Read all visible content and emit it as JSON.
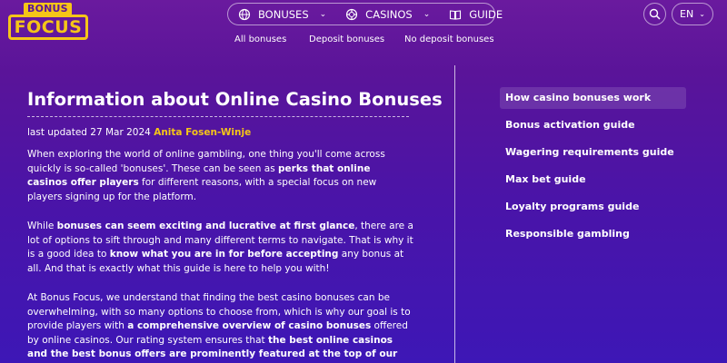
{
  "header": {
    "logo_top": "BONUS",
    "logo_bottom": "FOCUS",
    "nav": [
      {
        "label": "BONUSES",
        "icon": "globe-icon"
      },
      {
        "label": "CASINOS",
        "icon": "chip-icon"
      },
      {
        "label": "GUIDE",
        "icon": "book-icon"
      }
    ],
    "sub_nav": [
      "All bonuses",
      "Deposit bonuses",
      "No deposit bonuses"
    ],
    "lang": "EN"
  },
  "article": {
    "title": "Information about Online Casino Bonuses",
    "updated_prefix": "last updated 27 Mar 2024",
    "author": "Anita Fosen-Winje",
    "p1": [
      "When exploring the world of online gambling, one thing you'll come across quickly is so-called 'bonuses'. These can be seen as ",
      "perks that online casinos offer players",
      " for different reasons, with a special focus on new players signing up for the platform."
    ],
    "p2": [
      "While ",
      "bonuses can seem exciting and lucrative at first glance",
      ", there are a lot of options to sift through and many different terms to navigate. That is why it is a good idea to ",
      "know what you are in for before accepting",
      " any bonus at all. And that is exactly what this guide is here to help you with!"
    ],
    "p3": [
      "At Bonus Focus, we understand that finding the best casino bonuses can be overwhelming, with so many options to choose from, which is why our goal is to provide players with ",
      "a comprehensive overview of casino bonuses",
      " offered by online casinos. Our rating system ensures that ",
      "the best online casinos and the best bonus offers are prominently featured at the top of our website",
      "."
    ]
  },
  "toc": [
    "How casino bonuses work",
    "Bonus activation guide",
    "Wagering requirements guide",
    "Max bet guide",
    "Loyalty programs guide",
    "Responsible gambling"
  ],
  "colors": {
    "accent": "#f5c518",
    "background_top": "#6a1a9e",
    "background_bottom": "#3d17b6"
  }
}
